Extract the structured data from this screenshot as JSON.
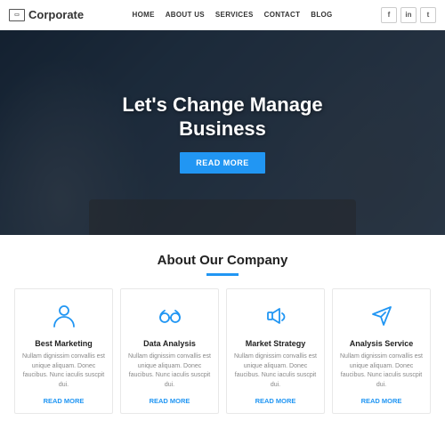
{
  "header": {
    "logo_text": "Corporate",
    "nav_items": [
      "HOME",
      "ABOUT US",
      "SERVICES",
      "CONTACT",
      "BLOG"
    ],
    "social_items": [
      "f",
      "in",
      "t"
    ]
  },
  "hero": {
    "line1": "Let's Change Manage",
    "line2": "Business",
    "cta_label": "READ MORE"
  },
  "about": {
    "title": "About Our Company",
    "cards": [
      {
        "id": "best-marketing",
        "title": "Best Marketing",
        "text": "Nullam dignissim convallis est unique aliquam. Donec faucibus. Nunc iaculis suscpit dui.",
        "link": "READ MORE",
        "icon": "person"
      },
      {
        "id": "data-analysis",
        "title": "Data Analysis",
        "text": "Nullam dignissim convallis est unique aliquam. Donec faucibus. Nunc iaculis suscpit dui.",
        "link": "READ MORE",
        "icon": "glasses"
      },
      {
        "id": "market-strategy",
        "title": "Market Strategy",
        "text": "Nullam dignissim convallis est unique aliquam. Donec faucibus. Nunc iaculis suscpit dui.",
        "link": "READ MORE",
        "icon": "speaker"
      },
      {
        "id": "analysis-service",
        "title": "Analysis Service",
        "text": "Nullam dignissim convallis est unique aliquam. Donec faucibus. Nunc iaculis suscpit dui.",
        "link": "READ MORE",
        "icon": "send"
      }
    ]
  }
}
